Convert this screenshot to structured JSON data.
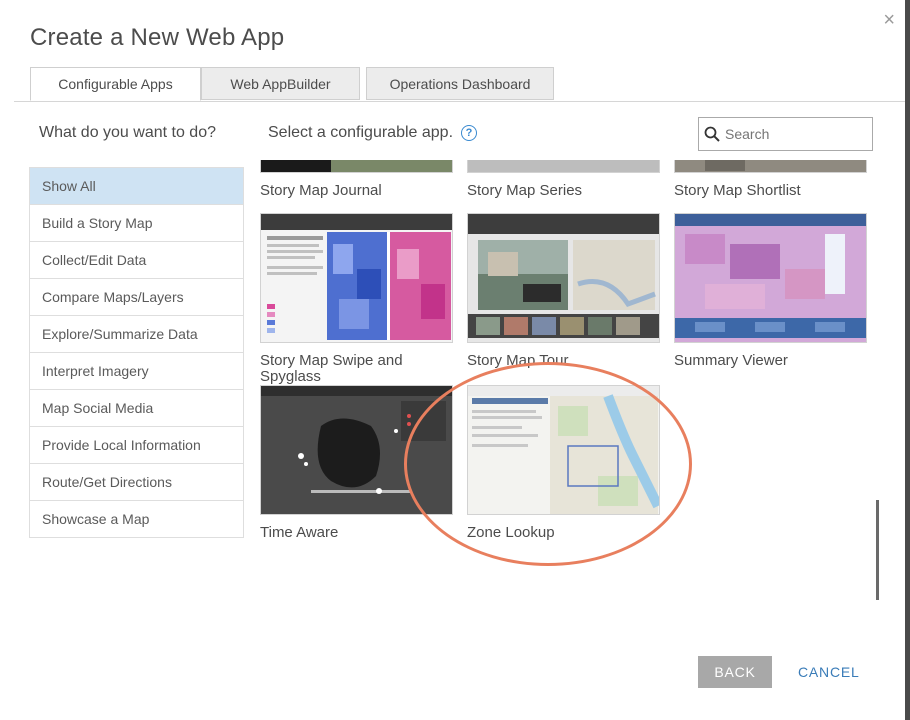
{
  "dialog": {
    "title": "Create a New Web App",
    "close_glyph": "×"
  },
  "tabs": [
    {
      "label": "Configurable Apps",
      "active": true
    },
    {
      "label": "Web AppBuilder",
      "active": false
    },
    {
      "label": "Operations Dashboard",
      "active": false
    }
  ],
  "left_question": "What do you want to do?",
  "right_prompt": "Select a configurable app.",
  "help_glyph": "?",
  "search": {
    "placeholder": "Search",
    "value": ""
  },
  "categories": [
    {
      "label": "Show All",
      "active": true
    },
    {
      "label": "Build a Story Map"
    },
    {
      "label": "Collect/Edit Data"
    },
    {
      "label": "Compare Maps/Layers"
    },
    {
      "label": "Explore/Summarize Data"
    },
    {
      "label": "Interpret Imagery"
    },
    {
      "label": "Map Social Media"
    },
    {
      "label": "Provide Local Information"
    },
    {
      "label": "Route/Get Directions"
    },
    {
      "label": "Showcase a Map"
    }
  ],
  "apps": [
    {
      "label": "Story Map Journal"
    },
    {
      "label": "Story Map Series"
    },
    {
      "label": "Story Map Shortlist"
    },
    {
      "label": "Story Map Swipe and Spyglass"
    },
    {
      "label": "Story Map Tour"
    },
    {
      "label": "Summary Viewer"
    },
    {
      "label": "Time Aware"
    },
    {
      "label": "Zone Lookup"
    }
  ],
  "buttons": {
    "back": "BACK",
    "cancel": "CANCEL"
  },
  "colors": {
    "accent": "#3a7cb8",
    "selected_category": "#cfe3f3",
    "highlight_circle": "#e87f5e"
  }
}
